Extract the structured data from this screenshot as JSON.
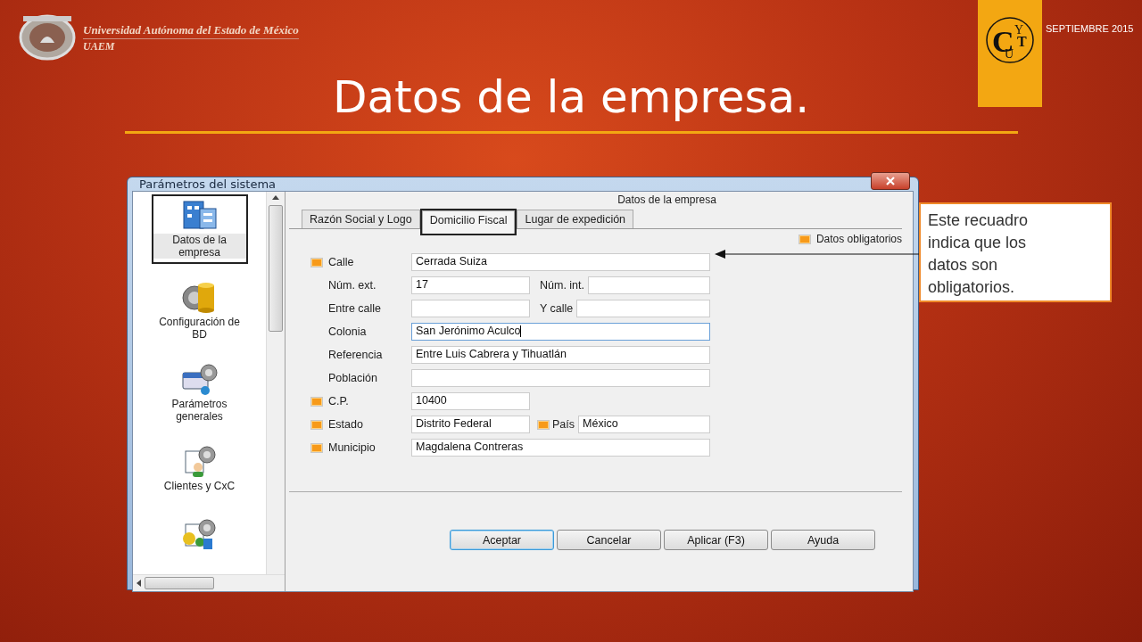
{
  "header": {
    "university": "Universidad Autónoma del Estado de México",
    "acronym": "UAEM",
    "date": "SEPTIEMBRE 2015",
    "badge_letters": [
      "C",
      "U",
      "Y",
      "T"
    ]
  },
  "slide_title": "Datos de la empresa.",
  "callout": "Este recuadro indica que los datos son obligatorios.",
  "window": {
    "title": "Parámetros del sistema"
  },
  "sidebar": {
    "items": [
      {
        "label": "Datos de la empresa",
        "selected": true,
        "kind": "building"
      },
      {
        "label": "Configuración de BD",
        "selected": false,
        "kind": "database"
      },
      {
        "label": "Parámetros generales",
        "selected": false,
        "kind": "window"
      },
      {
        "label": "Clientes y CxC",
        "selected": false,
        "kind": "client"
      },
      {
        "selected": false,
        "kind": "money"
      }
    ]
  },
  "section_title": "Datos de la empresa",
  "tabs": [
    {
      "label": "Razón Social y Logo",
      "selected": false
    },
    {
      "label": "Domicilio Fiscal",
      "selected": true
    },
    {
      "label": "Lugar de expedición",
      "selected": false
    }
  ],
  "legend": "Datos obligatorios",
  "rows": [
    {
      "fields": [
        {
          "label": "Calle",
          "required": true,
          "value": "Cerrada Suiza",
          "kind": "wide",
          "focused": false
        }
      ]
    },
    {
      "fields": [
        {
          "label": "Núm. ext.",
          "required": false,
          "value": "17",
          "kind": "short",
          "focused": false
        },
        {
          "label": "Núm. int.",
          "required": false,
          "kind": "wide",
          "focused": false
        }
      ]
    },
    {
      "fields": [
        {
          "label": "Entre calle",
          "required": false,
          "kind": "short",
          "focused": false
        },
        {
          "label": "Y calle",
          "required": false,
          "kind": "wide",
          "focused": false
        }
      ]
    },
    {
      "fields": [
        {
          "label": "Colonia",
          "required": false,
          "value": "San Jerónimo Aculco",
          "kind": "wide",
          "focused": true
        }
      ]
    },
    {
      "fields": [
        {
          "label": "Referencia",
          "required": false,
          "value": "Entre Luis Cabrera y Tihuatlán",
          "kind": "wide",
          "focused": false
        }
      ]
    },
    {
      "fields": [
        {
          "label": "Población",
          "required": false,
          "kind": "wide",
          "focused": false
        }
      ]
    },
    {
      "fields": [
        {
          "label": "C.P.",
          "required": true,
          "value": "10400",
          "kind": "short",
          "focused": false
        }
      ]
    },
    {
      "fields": [
        {
          "label": "Estado",
          "required": true,
          "value": "Distrito Federal",
          "kind": "short",
          "focused": false
        },
        {
          "label": "País",
          "required": true,
          "value": "México",
          "kind": "wide",
          "focused": false
        }
      ]
    },
    {
      "fields": [
        {
          "label": "Municipio",
          "required": true,
          "value": "Magdalena Contreras",
          "kind": "wide",
          "focused": false
        }
      ]
    }
  ],
  "buttons": [
    {
      "label": "Aceptar",
      "default": true
    },
    {
      "label": "Cancelar",
      "default": false
    },
    {
      "label": "Aplicar (F3)",
      "default": false
    },
    {
      "label": "Ayuda",
      "default": false
    }
  ]
}
